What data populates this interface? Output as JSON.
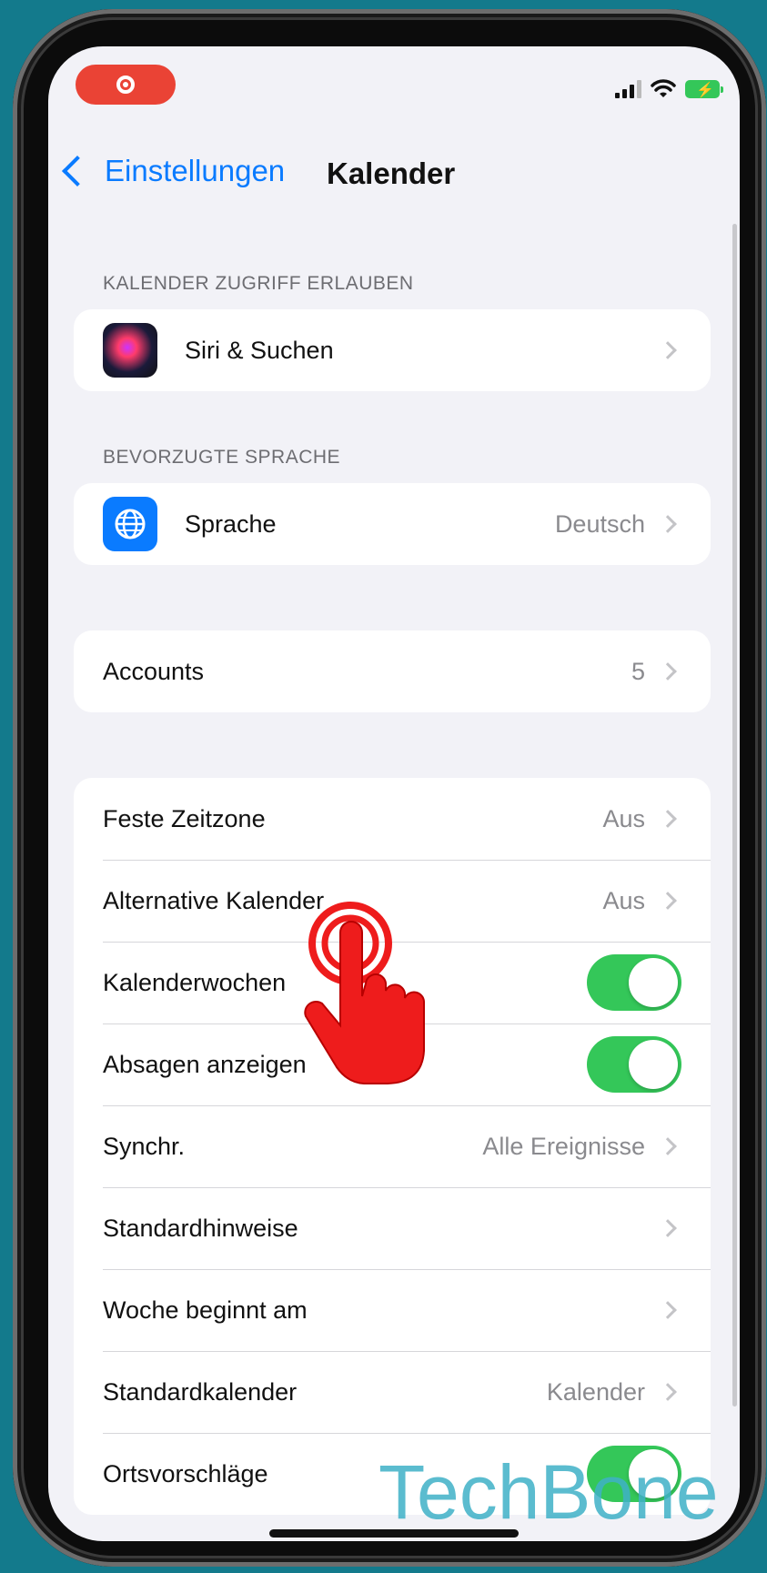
{
  "status_bar": {
    "recording_icon": "screen-recording-icon",
    "icons": [
      "signal-icon",
      "wifi-icon",
      "battery-charging-icon"
    ]
  },
  "nav": {
    "back_label": "Einstellungen",
    "title": "Kalender"
  },
  "sections": {
    "access_header": "KALENDER ZUGRIFF ERLAUBEN",
    "language_header": "BEVORZUGTE SPRACHE"
  },
  "siri": {
    "label": "Siri & Suchen"
  },
  "language": {
    "label": "Sprache",
    "value": "Deutsch"
  },
  "accounts": {
    "label": "Accounts",
    "value": "5"
  },
  "settings": {
    "fixed_timezone": {
      "label": "Feste Zeitzone",
      "value": "Aus"
    },
    "alt_calendar": {
      "label": "Alternative Kalender",
      "value": "Aus"
    },
    "week_numbers": {
      "label": "Kalenderwochen",
      "on": true
    },
    "show_declined": {
      "label": "Absagen anzeigen",
      "on": true
    },
    "sync": {
      "label": "Synchr.",
      "value": "Alle Ereignisse"
    },
    "default_alerts": {
      "label": "Standardhinweise"
    },
    "week_start": {
      "label": "Woche beginnt am"
    },
    "default_calendar": {
      "label": "Standardkalender",
      "value": "Kalender"
    },
    "location_suggestions": {
      "label": "Ortsvorschläge",
      "on": true
    }
  },
  "watermark": "TechBone",
  "colors": {
    "accent": "#0a7bff",
    "toggle_on": "#34c759",
    "tap_hand": "#ee1c1c",
    "background": "#137a8c"
  }
}
